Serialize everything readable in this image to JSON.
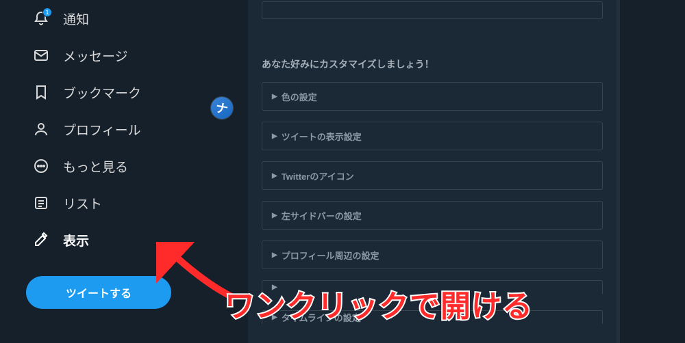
{
  "sidebar": {
    "items": [
      {
        "label": "通知",
        "icon": "bell-icon",
        "badge": "1"
      },
      {
        "label": "メッセージ",
        "icon": "mail-icon"
      },
      {
        "label": "ブックマーク",
        "icon": "bookmark-icon"
      },
      {
        "label": "プロフィール",
        "icon": "profile-icon"
      },
      {
        "label": "もっと見る",
        "icon": "more-icon"
      },
      {
        "label": "リスト",
        "icon": "list-icon"
      },
      {
        "label": "表示",
        "icon": "edit-icon",
        "active": true
      }
    ],
    "tweet_button": "ツイートする"
  },
  "main": {
    "section_title": "あなた好みにカスタマイズしましょう！",
    "accordions": [
      "色の設定",
      "ツイートの表示設定",
      "Twitterのアイコン",
      "左サイドバーの設定",
      "プロフィール周辺の設定",
      "",
      "タイムラインの設定"
    ]
  },
  "circle_badge": "ナ",
  "overlay_text": "ワンクリックで開ける"
}
